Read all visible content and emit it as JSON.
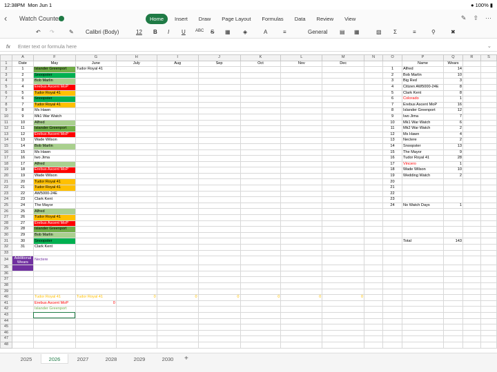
{
  "status": {
    "time": "12:38PM",
    "date": "Mon Jun 1",
    "battery": "100%"
  },
  "title": "Watch Counter",
  "tabs": [
    "Home",
    "Insert",
    "Draw",
    "Page Layout",
    "Formulas",
    "Data",
    "Review",
    "View"
  ],
  "toolbar": {
    "font": "Calibri (Body)",
    "size": "12",
    "format": "General"
  },
  "formula_placeholder": "Enter text or formula here",
  "col_headers": [
    "A",
    "F",
    "G",
    "H",
    "I",
    "J",
    "K",
    "L",
    "M",
    "N",
    "O",
    "P",
    "Q",
    "R",
    "S"
  ],
  "header_row": {
    "a": "Date",
    "f": "May",
    "g": "June",
    "h": "July",
    "i": "Aug",
    "j": "Sep",
    "k": "Oct",
    "l": "Nov",
    "m": "Dec",
    "p": "Name",
    "q": "Wears"
  },
  "may": [
    {
      "d": "1",
      "w": "Islander Greenport",
      "c": "g-dk"
    },
    {
      "d": "2",
      "w": "Snoopster",
      "c": "g-br"
    },
    {
      "d": "3",
      "w": "Bob Marlin",
      "c": "g-lt"
    },
    {
      "d": "4",
      "w": "Erebus Ascent MoP",
      "c": "red"
    },
    {
      "d": "5",
      "w": "Tudor Royal 41",
      "c": "org"
    },
    {
      "d": "6",
      "w": "Snoopster",
      "c": "g-br"
    },
    {
      "d": "7",
      "w": "Tudor Royal 41",
      "c": "org"
    },
    {
      "d": "8",
      "w": "Ms Hawn",
      "c": ""
    },
    {
      "d": "9",
      "w": "Mk1 War Watch",
      "c": ""
    },
    {
      "d": "10",
      "w": "Alfred",
      "c": "g-lt"
    },
    {
      "d": "11",
      "w": "Islander Greenport",
      "c": "g-dk"
    },
    {
      "d": "12",
      "w": "Erebus Ascent MoP",
      "c": "red"
    },
    {
      "d": "13",
      "w": "Wade Wilson",
      "c": ""
    },
    {
      "d": "14",
      "w": "Bob Marlin",
      "c": "g-lt"
    },
    {
      "d": "15",
      "w": "Ms Hawn",
      "c": ""
    },
    {
      "d": "16",
      "w": "Iwo Jima",
      "c": ""
    },
    {
      "d": "17",
      "w": "Alfred",
      "c": "g-lt"
    },
    {
      "d": "18",
      "w": "Erebus Ascent MoP",
      "c": "red"
    },
    {
      "d": "19",
      "w": "Wade Wilson",
      "c": ""
    },
    {
      "d": "20",
      "w": "Tudor Royal 41",
      "c": "org"
    },
    {
      "d": "21",
      "w": "Tudor Royal 41",
      "c": "org"
    },
    {
      "d": "22",
      "w": "AW5000-24E",
      "c": ""
    },
    {
      "d": "23",
      "w": "Clark Kent",
      "c": ""
    },
    {
      "d": "24",
      "w": "The Mayor",
      "c": ""
    },
    {
      "d": "25",
      "w": "Alfred",
      "c": "g-lt"
    },
    {
      "d": "26",
      "w": "Tudor Royal 41",
      "c": "org"
    },
    {
      "d": "27",
      "w": "Erebus Ascent MoP",
      "c": "red"
    },
    {
      "d": "28",
      "w": "Islander Greenport",
      "c": "g-dk"
    },
    {
      "d": "29",
      "w": "Bob Marlin",
      "c": "g-lt"
    },
    {
      "d": "30",
      "w": "Snoopster",
      "c": "g-br"
    },
    {
      "d": "31",
      "w": "Clark Kent",
      "c": ""
    }
  ],
  "june_first": "Tudor Royal 41",
  "summary": [
    {
      "n": "1",
      "name": "Alfred",
      "wears": "14",
      "c": ""
    },
    {
      "n": "2",
      "name": "Bob Marlin",
      "wears": "10",
      "c": ""
    },
    {
      "n": "3",
      "name": "Big Red",
      "wears": "3",
      "c": ""
    },
    {
      "n": "4",
      "name": "Citizen AW5000-24E",
      "wears": "8",
      "c": ""
    },
    {
      "n": "5",
      "name": "Clark Kent",
      "wears": "8",
      "c": ""
    },
    {
      "n": "6",
      "name": "Colorado",
      "wears": "1",
      "c": "tx-red"
    },
    {
      "n": "7",
      "name": "Erebus Ascent MoP",
      "wears": "16",
      "c": ""
    },
    {
      "n": "8",
      "name": "Islander Greenport",
      "wears": "12",
      "c": ""
    },
    {
      "n": "9",
      "name": "Iwo Jima",
      "wears": "7",
      "c": ""
    },
    {
      "n": "10",
      "name": "Mk1 War Watch",
      "wears": "6",
      "c": ""
    },
    {
      "n": "11",
      "name": "Mk2 War Watch",
      "wears": "2",
      "c": ""
    },
    {
      "n": "12",
      "name": "Ms Hawn",
      "wears": "4",
      "c": ""
    },
    {
      "n": "13",
      "name": "Nectere",
      "wears": "2",
      "c": ""
    },
    {
      "n": "14",
      "name": "Snoopster",
      "wears": "13",
      "c": ""
    },
    {
      "n": "15",
      "name": "The Mayor",
      "wears": "9",
      "c": ""
    },
    {
      "n": "16",
      "name": "Tudor Royal 41",
      "wears": "28",
      "c": ""
    },
    {
      "n": "17",
      "name": "Vincero",
      "wears": "1",
      "c": "tx-red"
    },
    {
      "n": "18",
      "name": "Wade Wilson",
      "wears": "10",
      "c": ""
    },
    {
      "n": "19",
      "name": "Wedding Watch",
      "wears": "2",
      "c": ""
    },
    {
      "n": "20",
      "name": "",
      "wears": "",
      "c": ""
    },
    {
      "n": "21",
      "name": "",
      "wears": "",
      "c": ""
    },
    {
      "n": "22",
      "name": "",
      "wears": "",
      "c": ""
    },
    {
      "n": "23",
      "name": "",
      "wears": "",
      "c": ""
    },
    {
      "n": "24",
      "name": "No Watch Days",
      "wears": "1",
      "c": ""
    }
  ],
  "total_label": "Total",
  "total_value": "143",
  "additional_wears": "Additional Wears",
  "nectere": "Nectere",
  "row40": {
    "f": "Tudor Royal 41",
    "g": "Tudor Royal 41",
    "h": "0",
    "i": "0",
    "j": "0",
    "k": "0",
    "l": "0",
    "m": "0"
  },
  "row41": {
    "f": "Erebus Ascent MoP",
    "g": "0"
  },
  "row42": {
    "f": "Islander Greenport"
  },
  "sheet_tabs": [
    "2025",
    "2026",
    "2027",
    "2028",
    "2029",
    "2030"
  ],
  "active_sheet": "2026"
}
